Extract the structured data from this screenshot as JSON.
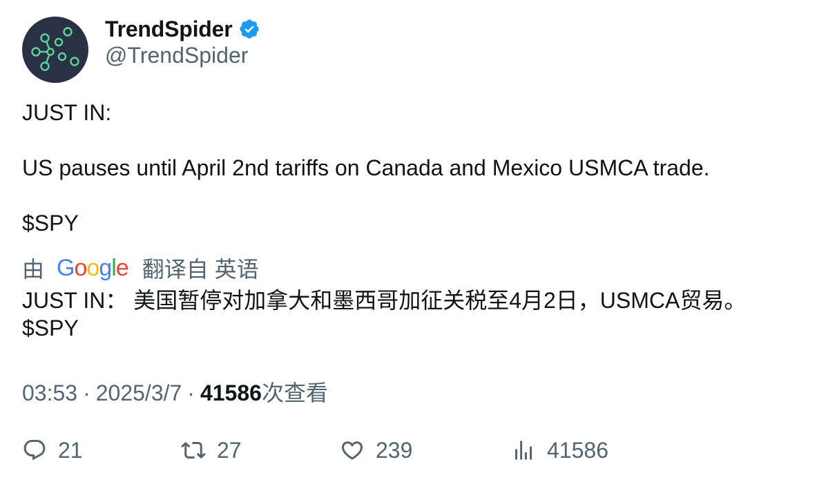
{
  "author": {
    "display_name": "TrendSpider",
    "handle": "@TrendSpider",
    "verified": true,
    "verified_color": "#1d9bf0",
    "avatar_bg": "#2b3145",
    "avatar_accent": "#5fd49a"
  },
  "tweet": {
    "lines": [
      "JUST IN:",
      "",
      "US pauses until April 2nd tariffs on Canada and Mexico USMCA trade.",
      "",
      "$SPY"
    ]
  },
  "translation": {
    "by_label": "由",
    "provider": "Google",
    "from_label": "翻译自 英语",
    "lines": [
      "JUST IN： 美国暂停对加拿大和墨西哥加征关税至4月2日，USMCA贸易。",
      "$SPY"
    ]
  },
  "meta": {
    "time": "03:53",
    "separator": "·",
    "date": "2025/3/7",
    "views_count": "41586",
    "views_label": "次查看"
  },
  "actions": {
    "replies": "21",
    "retweets": "27",
    "likes": "239",
    "views": "41586"
  },
  "colors": {
    "text_primary": "#0f1419",
    "text_secondary": "#536471",
    "google_blue": "#4285F4",
    "google_red": "#EA4335",
    "google_yellow": "#FBBC05",
    "google_green": "#34A853"
  }
}
